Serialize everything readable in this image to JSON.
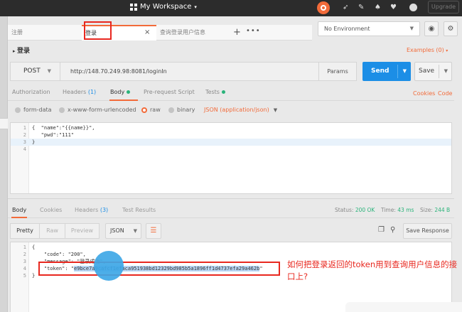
{
  "topbar": {
    "workspace_title": "My Workspace",
    "upgrade_label": "Upgrade"
  },
  "tabs": [
    {
      "label": "注册"
    },
    {
      "label": "登录"
    },
    {
      "label": "查询登录用户信息"
    }
  ],
  "tab_close": "×",
  "tab_add": "+",
  "tab_more": "•••",
  "environment": {
    "selected": "No Environment"
  },
  "request": {
    "name": "登录",
    "examples": "Examples (0)",
    "method": "POST",
    "url": "http://148.70.249.98:8081/loginIn",
    "params_label": "Params",
    "send_label": "Send",
    "save_label": "Save"
  },
  "request_tabs": [
    {
      "label": "Authorization",
      "count": ""
    },
    {
      "label": "Headers",
      "count": "(1)"
    },
    {
      "label": "Body",
      "count": ""
    },
    {
      "label": "Pre-request Script",
      "count": ""
    },
    {
      "label": "Tests",
      "count": ""
    }
  ],
  "request_links": {
    "cookies": "Cookies",
    "code": "Code"
  },
  "body_types": [
    "form-data",
    "x-www-form-urlencoded",
    "raw",
    "binary"
  ],
  "body_selected": "raw",
  "content_type": "JSON (application/json)",
  "request_body": [
    {
      "ln": "1",
      "text": "{  \"name\":\"{{name}}\","
    },
    {
      "ln": "2",
      "text": "   \"pwd\":\"111\""
    },
    {
      "ln": "3",
      "text": "}"
    },
    {
      "ln": "4",
      "text": ""
    }
  ],
  "response_tabs": [
    {
      "label": "Body",
      "count": ""
    },
    {
      "label": "Cookies",
      "count": ""
    },
    {
      "label": "Headers",
      "count": "(3)"
    },
    {
      "label": "Test Results",
      "count": ""
    }
  ],
  "response_status": {
    "status_label": "Status:",
    "status_value": "200 OK",
    "time_label": "Time:",
    "time_value": "43 ms",
    "size_label": "Size:",
    "size_value": "244 B"
  },
  "response_formats": [
    "Pretty",
    "Raw",
    "Preview"
  ],
  "response_format_selected": "Pretty",
  "response_lang": "JSON",
  "save_response_label": "Save Response",
  "response_body": [
    {
      "ln": "1",
      "text": "{"
    },
    {
      "ln": "2",
      "text": "    \"code\": \"200\","
    },
    {
      "ln": "3",
      "text": "    \"message\": \"登录成功\","
    },
    {
      "ln": "4",
      "prefix": "    \"token\": \"",
      "token": "e9bce7a9cafcf1efaca951938bd12329bd985b5a1896ff1d4737efa29a462b",
      "suffix": "\""
    },
    {
      "ln": "5",
      "text": "}"
    }
  ],
  "annotation": "如何把登录返回的token用到查询用户信息的接口上?",
  "colors": {
    "accent": "#f26b3a",
    "send": "#1c8ee6",
    "annotation": "#e8281f",
    "ok": "#2ab37a"
  }
}
